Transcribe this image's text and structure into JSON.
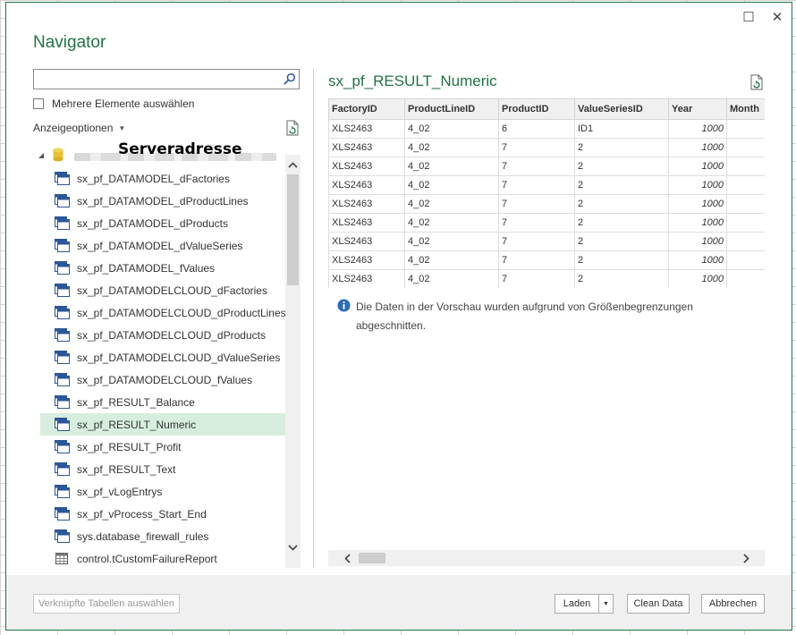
{
  "window": {
    "title": "Navigator",
    "maximize_glyph": "☐",
    "close_glyph": "✕"
  },
  "left": {
    "search": {
      "value": "",
      "placeholder": ""
    },
    "multi_select_label": "Mehrere Elemente auswählen",
    "display_options_label": "Anzeigeoptionen",
    "display_options_caret": "▼",
    "server_label": "Serveradresse",
    "tree_caret": "◢",
    "items": [
      {
        "label": "sx_pf_DATAMODEL_dFactories"
      },
      {
        "label": "sx_pf_DATAMODEL_dProductLines"
      },
      {
        "label": "sx_pf_DATAMODEL_dProducts"
      },
      {
        "label": "sx_pf_DATAMODEL_dValueSeries"
      },
      {
        "label": "sx_pf_DATAMODEL_fValues"
      },
      {
        "label": "sx_pf_DATAMODELCLOUD_dFactories"
      },
      {
        "label": "sx_pf_DATAMODELCLOUD_dProductLines"
      },
      {
        "label": "sx_pf_DATAMODELCLOUD_dProducts"
      },
      {
        "label": "sx_pf_DATAMODELCLOUD_dValueSeries"
      },
      {
        "label": "sx_pf_DATAMODELCLOUD_fValues"
      },
      {
        "label": "sx_pf_RESULT_Balance"
      },
      {
        "label": "sx_pf_RESULT_Numeric",
        "selected": true
      },
      {
        "label": "sx_pf_RESULT_Profit"
      },
      {
        "label": "sx_pf_RESULT_Text"
      },
      {
        "label": "sx_pf_vLogEntrys"
      },
      {
        "label": "sx_pf_vProcess_Start_End"
      },
      {
        "label": "sys.database_firewall_rules"
      },
      {
        "label": "control.tCustomFailureReport",
        "type": "table"
      }
    ]
  },
  "preview": {
    "title": "sx_pf_RESULT_Numeric",
    "columns": [
      "FactoryID",
      "ProductLineID",
      "ProductID",
      "ValueSeriesID",
      "Year",
      "Month"
    ],
    "rows": [
      [
        "XLS2463",
        "4_02",
        "6",
        "ID1",
        "1000",
        ""
      ],
      [
        "XLS2463",
        "4_02",
        "7",
        "2",
        "1000",
        ""
      ],
      [
        "XLS2463",
        "4_02",
        "7",
        "2",
        "1000",
        ""
      ],
      [
        "XLS2463",
        "4_02",
        "7",
        "2",
        "1000",
        ""
      ],
      [
        "XLS2463",
        "4_02",
        "7",
        "2",
        "1000",
        ""
      ],
      [
        "XLS2463",
        "4_02",
        "7",
        "2",
        "1000",
        ""
      ],
      [
        "XLS2463",
        "4_02",
        "7",
        "2",
        "1000",
        ""
      ],
      [
        "XLS2463",
        "4_02",
        "7",
        "2",
        "1000",
        ""
      ],
      [
        "XLS2463",
        "4_02",
        "7",
        "2",
        "1000",
        ""
      ]
    ],
    "info_line1": "Die Daten in der Vorschau wurden aufgrund von Größenbegrenzungen",
    "info_line2": "abgeschnitten."
  },
  "footer": {
    "related_tables_label": "Verknüpfte Tabellen auswählen",
    "load_label": "Laden",
    "load_caret": "▼",
    "clean_data_label": "Clean Data",
    "cancel_label": "Abbrechen"
  },
  "colors": {
    "accent": "#217346",
    "selection": "#d7eedf",
    "icon_blue": "#2b579a"
  }
}
